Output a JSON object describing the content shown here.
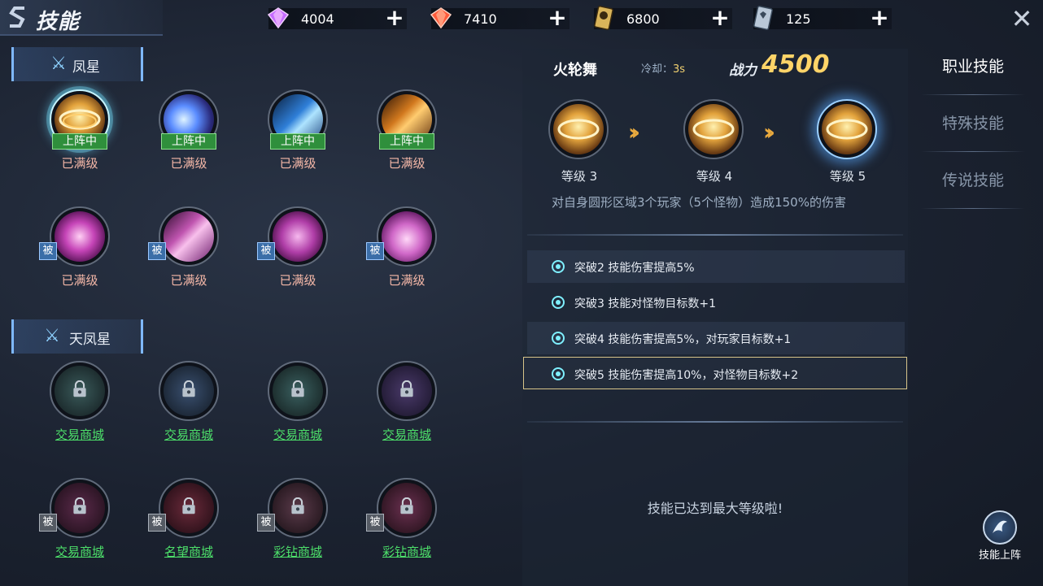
{
  "header": {
    "title": "技能",
    "currencies": [
      {
        "icon": "purple-gem-icon",
        "value": "4004"
      },
      {
        "icon": "red-gem-icon",
        "value": "7410"
      },
      {
        "icon": "coin-card-icon",
        "value": "6800"
      },
      {
        "icon": "ticket-card-icon",
        "value": "125"
      }
    ],
    "close_icon": "close-icon"
  },
  "left": {
    "sections": [
      {
        "title": "凤星",
        "rows": [
          [
            {
              "status": "已满级",
              "tag": "上阵中",
              "art": "fire-ring"
            },
            {
              "status": "已满级",
              "tag": "上阵中",
              "art": "blue-dash"
            },
            {
              "status": "已满级",
              "tag": "上阵中",
              "art": "blue-wave"
            },
            {
              "status": "已满级",
              "tag": "上阵中",
              "art": "orange-strike"
            }
          ],
          [
            {
              "status": "已满级",
              "passive": "被",
              "art": "pink-beast"
            },
            {
              "status": "已满级",
              "passive": "被",
              "art": "pink-claws"
            },
            {
              "status": "已满级",
              "passive": "被",
              "art": "pink-sword"
            },
            {
              "status": "已满级",
              "passive": "被",
              "art": "pink-demon"
            }
          ]
        ]
      },
      {
        "title": "天凤星",
        "rows": [
          [
            {
              "link": "交易商城",
              "art": "teal-locked"
            },
            {
              "link": "交易商城",
              "art": "blue-locked"
            },
            {
              "link": "交易商城",
              "art": "cyan-locked"
            },
            {
              "link": "交易商城",
              "art": "purple-locked"
            }
          ],
          [
            {
              "link": "交易商城",
              "passive": "被",
              "art": "magenta-locked"
            },
            {
              "link": "名望商城",
              "passive": "被",
              "art": "red-locked"
            },
            {
              "link": "彩钻商城",
              "passive": "被",
              "art": "mauve-locked"
            },
            {
              "link": "彩钻商城",
              "passive": "被",
              "art": "pink-locked"
            }
          ]
        ]
      }
    ]
  },
  "detail": {
    "name": "火轮舞",
    "cooldown_label": "冷却：",
    "cooldown_value": "3s",
    "power_label": "战力",
    "power_value": "4500",
    "levels": [
      "等级 3",
      "等级 4",
      "等级 5"
    ],
    "description": "对自身圆形区域3个玩家（5个怪物）造成150%的伤害",
    "breakthroughs": [
      "突破2  技能伤害提高5%",
      "突破3  技能对怪物目标数+1",
      "突破4  技能伤害提高5%，对玩家目标数+1",
      "突破5  技能伤害提高10%，对怪物目标数+2"
    ],
    "max_message": "技能已达到最大等级啦!"
  },
  "tabs": [
    "职业技能",
    "特殊技能",
    "传说技能"
  ],
  "deploy_button": "技能上阵",
  "colors": {
    "accent_gold": "#ffd468",
    "link_green": "#4de06a",
    "status_pink": "#f5b8a8",
    "tag_green": "#2f8f3c",
    "passive_blue": "#3b6ea8"
  }
}
